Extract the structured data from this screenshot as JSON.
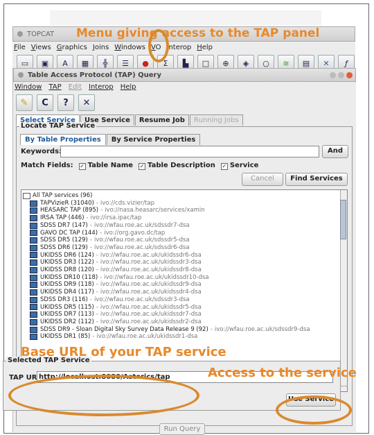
{
  "topcat": {
    "title": "TOPCAT",
    "menu": [
      "File",
      "Views",
      "Graphics",
      "Joins",
      "Windows",
      "VO",
      "Interop",
      "Help"
    ]
  },
  "tap_window": {
    "title": "Table Access Protocol (TAP) Query",
    "menu": [
      "Window",
      "TAP",
      "Edit",
      "Interop",
      "Help"
    ],
    "tabs": [
      "Select Service",
      "Use Service",
      "Resume Job",
      "Running Jobs"
    ],
    "locate_label": "Locate TAP Service",
    "subtabs": [
      "By Table Properties",
      "By Service Properties"
    ],
    "keywords_label": "Keywords:",
    "and_button": "And",
    "match_label": "Match Fields:",
    "match_fields": [
      "Table Name",
      "Table Description",
      "Service"
    ],
    "cancel_button": "Cancel",
    "find_button": "Find Services",
    "tree_root": "All TAP services (96)",
    "services": [
      {
        "name": "TAPVizieR (31040)",
        "id": "ivo://cds.vizier/tap"
      },
      {
        "name": "HEASARC TAP (895)",
        "id": "ivo://nasa.heasarc/services/xamin"
      },
      {
        "name": "IRSA TAP (446)",
        "id": "ivo://irsa.ipac/tap"
      },
      {
        "name": "SDSS DR7 (147)",
        "id": "ivo://wfau.roe.ac.uk/sdssdr7-dsa"
      },
      {
        "name": "GAVO DC TAP (144)",
        "id": "ivo://org.gavo.dc/tap"
      },
      {
        "name": "SDSS DR5 (129)",
        "id": "ivo://wfau.roe.ac.uk/sdssdr5-dsa"
      },
      {
        "name": "SDSS DR6 (129)",
        "id": "ivo://wfau.roe.ac.uk/sdssdr6-dsa"
      },
      {
        "name": "UKIDSS DR6 (124)",
        "id": "ivo://wfau.roe.ac.uk/ukidssdr6-dsa"
      },
      {
        "name": "UKIDSS DR3 (122)",
        "id": "ivo://wfau.roe.ac.uk/ukidssdr3-dsa"
      },
      {
        "name": "UKIDSS DR8 (120)",
        "id": "ivo://wfau.roe.ac.uk/ukidssdr8-dsa"
      },
      {
        "name": "UKIDSS DR10 (118)",
        "id": "ivo://wfau.roe.ac.uk/ukidssdr10-dsa"
      },
      {
        "name": "UKIDSS DR9 (118)",
        "id": "ivo://wfau.roe.ac.uk/ukidssdr9-dsa"
      },
      {
        "name": "UKIDSS DR4 (117)",
        "id": "ivo://wfau.roe.ac.uk/ukidssdr4-dsa"
      },
      {
        "name": "SDSS DR3 (116)",
        "id": "ivo://wfau.roe.ac.uk/sdssdr3-dsa"
      },
      {
        "name": "UKIDSS DR5 (115)",
        "id": "ivo://wfau.roe.ac.uk/ukidssdr5-dsa"
      },
      {
        "name": "UKIDSS DR7 (113)",
        "id": "ivo://wfau.roe.ac.uk/ukidssdr7-dsa"
      },
      {
        "name": "UKIDSS DR2 (112)",
        "id": "ivo://wfau.roe.ac.uk/ukidssdr2-dsa"
      },
      {
        "name": "SDSS DR9 - Sloan Digital Sky Survey Data Release 9 (92)",
        "id": "ivo://wfau.roe.ac.uk/sdssdr9-dsa"
      },
      {
        "name": "UKIDSS DR1 (85)",
        "id": "ivo://wfau.roe.ac.uk/ukidssdr1-dsa"
      }
    ],
    "selected_label": "Selected TAP Service",
    "tap_url_label": "TAP URL:",
    "tap_url": "http://localhost:8080/Asterics/tap",
    "use_service_button": "Use Service",
    "run_query_button": "Run Query"
  },
  "annotations": {
    "menu": "Menu giving access to the TAP panel",
    "base_url": "Base URL of your TAP service",
    "access": "Access to the service",
    "color": "#e8892a"
  }
}
